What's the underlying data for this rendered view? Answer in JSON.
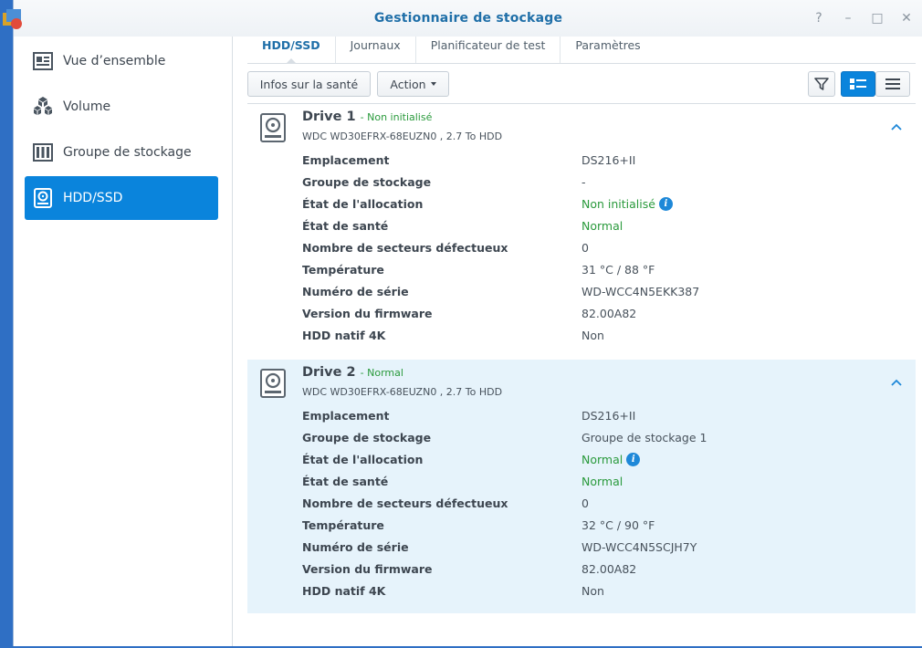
{
  "window": {
    "title": "Gestionnaire de stockage",
    "controls": [
      "?",
      "–",
      "□",
      "✕"
    ]
  },
  "sidebar": {
    "items": [
      {
        "label": "Vue d’ensemble",
        "icon": "overview-icon",
        "active": false
      },
      {
        "label": "Volume",
        "icon": "volume-cubes-icon",
        "active": false
      },
      {
        "label": "Groupe de stockage",
        "icon": "storage-pool-icon",
        "active": false
      },
      {
        "label": "HDD/SSD",
        "icon": "hdd-icon",
        "active": true
      }
    ]
  },
  "tabs": [
    {
      "label": "HDD/SSD",
      "active": true
    },
    {
      "label": "Journaux",
      "active": false
    },
    {
      "label": "Planificateur de test",
      "active": false
    },
    {
      "label": "Paramètres",
      "active": false
    }
  ],
  "toolbar": {
    "health_label": "Infos sur la santé",
    "action_label": "Action"
  },
  "colors": {
    "accent": "#0a84dc",
    "title": "#1f6fa8",
    "ok_green": "#2a9a3c",
    "selected_row_bg": "#e6f3fb"
  },
  "drives": [
    {
      "name": "Drive 1",
      "status": "- Non initialisé",
      "model": "WDC WD30EFRX-68EUZN0 , 2.7 To HDD",
      "rows": [
        {
          "k": "Emplacement",
          "v": "DS216+II"
        },
        {
          "k": "Groupe de stockage",
          "v": "-"
        },
        {
          "k": "État de l'allocation",
          "v": "Non initialisé"
        },
        {
          "k": "État de santé",
          "v": "Normal"
        },
        {
          "k": "Nombre de secteurs défectueux",
          "v": "0"
        },
        {
          "k": "Température",
          "v": "31 °C / 88 °F"
        },
        {
          "k": "Numéro de série",
          "v": "WD-WCC4N5EKK387"
        },
        {
          "k": "Version du firmware",
          "v": "82.00A82"
        },
        {
          "k": "HDD natif 4K",
          "v": "Non"
        }
      ]
    },
    {
      "name": "Drive 2",
      "status": "- Normal",
      "model": "WDC WD30EFRX-68EUZN0 , 2.7 To HDD",
      "rows": [
        {
          "k": "Emplacement",
          "v": "DS216+II"
        },
        {
          "k": "Groupe de stockage",
          "v": "Groupe de stockage 1"
        },
        {
          "k": "État de l'allocation",
          "v": "Normal"
        },
        {
          "k": "État de santé",
          "v": "Normal"
        },
        {
          "k": "Nombre de secteurs défectueux",
          "v": "0"
        },
        {
          "k": "Température",
          "v": "32 °C / 90 °F"
        },
        {
          "k": "Numéro de série",
          "v": "WD-WCC4N5SCJH7Y"
        },
        {
          "k": "Version du firmware",
          "v": "82.00A82"
        },
        {
          "k": "HDD natif 4K",
          "v": "Non"
        }
      ]
    }
  ]
}
